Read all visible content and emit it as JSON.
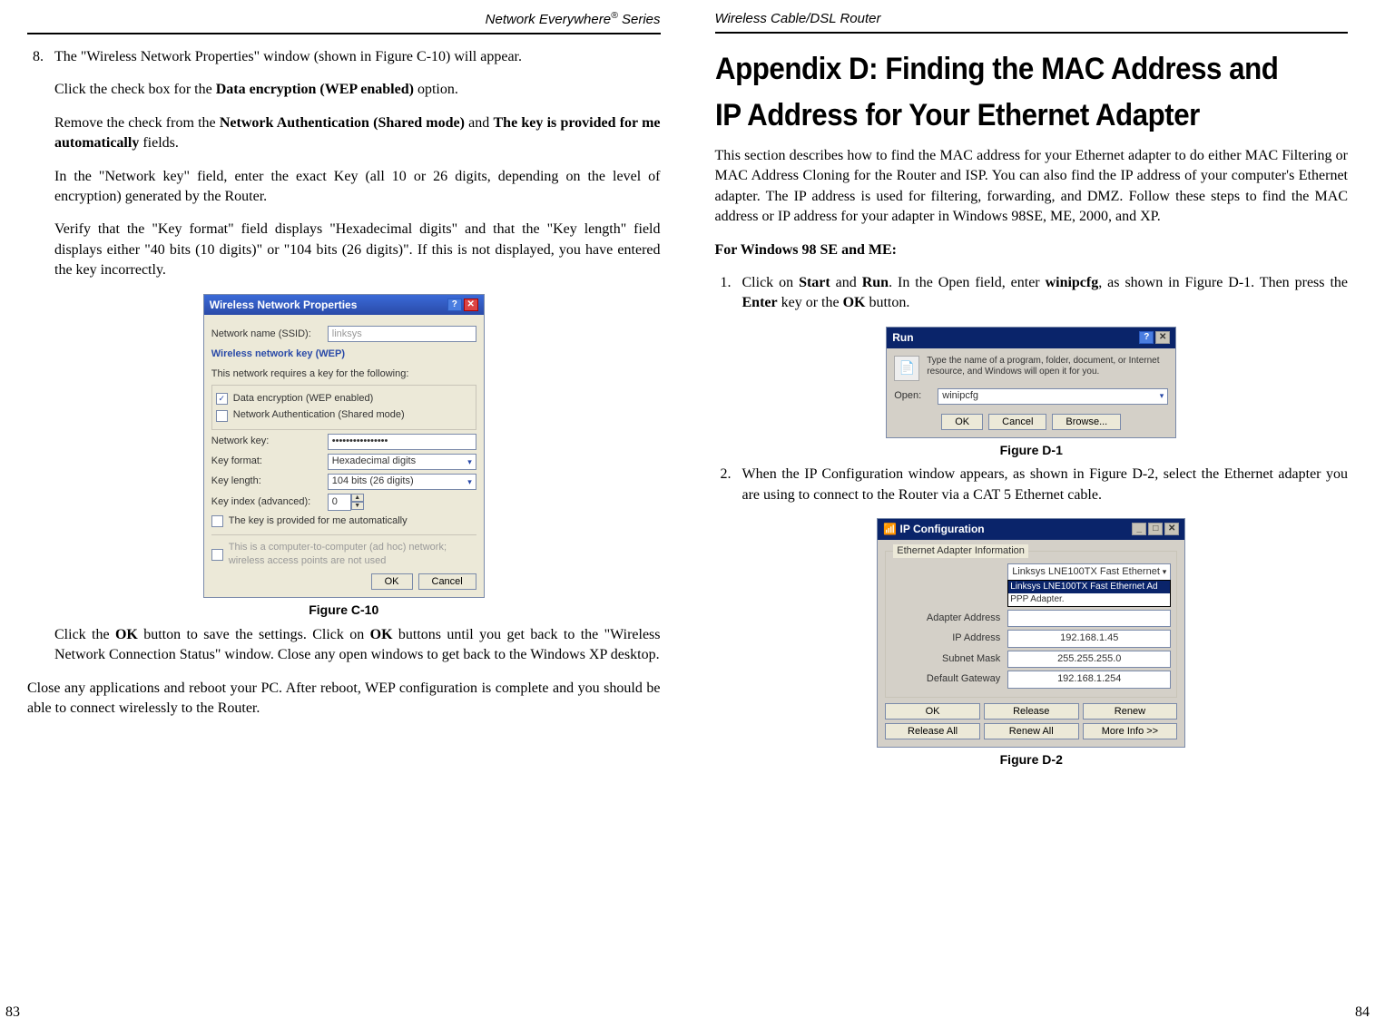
{
  "left_page": {
    "header": "Network Everywhere® Series",
    "page_number": "83",
    "step8": {
      "num": "8.",
      "intro": "The \"Wireless Network Properties\" window (shown in Figure C-10) will appear.",
      "click_checkbox_1": "Click the check box for the ",
      "click_checkbox_bold": "Data encryption (WEP enabled)",
      "click_checkbox_2": " option.",
      "remove_1": "Remove the check from the ",
      "remove_bold1": "Network Authentication (Shared mode)",
      "remove_2": " and ",
      "remove_bold2": "The key is provided for me automatically",
      "remove_3": " fields.",
      "network_key": "In the \"Network key\" field, enter the exact Key (all 10 or 26 digits, depending on the level of encryption) generated by the Router.",
      "verify": "Verify that the \"Key format\" field displays \"Hexadecimal digits\" and that the \"Key length\" field displays either \"40 bits (10 digits)\" or \"104 bits (26 digits)\". If this is not displayed, you have entered the key incorrectly."
    },
    "figure_c10": {
      "caption": "Figure C-10",
      "title": "Wireless Network Properties",
      "ssid_label": "Network name (SSID):",
      "ssid_value": "linksys",
      "wep_header": "Wireless network key (WEP)",
      "wep_desc": "This network requires a key for the following:",
      "chk_data_enc": "Data encryption (WEP enabled)",
      "chk_net_auth": "Network Authentication (Shared mode)",
      "key_label": "Network key:",
      "key_value": "••••••••••••••••",
      "format_label": "Key format:",
      "format_value": "Hexadecimal digits",
      "length_label": "Key length:",
      "length_value": "104 bits (26 digits)",
      "index_label": "Key index (advanced):",
      "index_value": "0",
      "chk_auto": "The key is provided for me automatically",
      "adhoc_text": "This is a computer-to-computer (ad hoc) network; wireless access points are not used",
      "ok": "OK",
      "cancel": "Cancel"
    },
    "click_ok_1": "Click the ",
    "click_ok_bold1": "OK",
    "click_ok_2": " button to save the settings.  Click on ",
    "click_ok_bold2": "OK",
    "click_ok_3": " buttons until you get back to the \"Wireless Network Connection Status\" window.  Close any open windows to get back to the Windows XP desktop.",
    "close_apps": "Close any applications and reboot your PC.  After reboot, WEP configuration is complete and you should be able to connect wirelessly to the Router."
  },
  "right_page": {
    "header": "Wireless Cable/DSL Router",
    "page_number": "84",
    "title": "Appendix D: Finding the MAC Address and IP Address for Your Ethernet Adapter",
    "intro": "This section describes how to find the MAC address for your Ethernet adapter to do either MAC Filtering or MAC Address Cloning for the Router and ISP. You can also find the IP address of your computer's Ethernet adapter.  The IP address is used for filtering, forwarding, and DMZ.  Follow these steps to find the MAC address or IP address for your adapter in Windows 98SE, ME, 2000, and XP.",
    "for_win": "For Windows 98 SE and ME:",
    "step1": {
      "num": "1.",
      "p1": "Click on ",
      "b1": "Start",
      "p2": " and ",
      "b2": "Run",
      "p3": ". In the Open field, enter ",
      "b3": "winipcfg",
      "p4": ", as shown in Figure D-1. Then press the ",
      "b4": "Enter",
      "p5": " key or the ",
      "b5": "OK",
      "p6": " button."
    },
    "figure_d1": {
      "caption": "Figure D-1",
      "title": "Run",
      "desc": "Type the name of a program, folder, document, or Internet resource, and Windows will open it for you.",
      "open_label": "Open:",
      "open_value": "winipcfg",
      "ok": "OK",
      "cancel": "Cancel",
      "browse": "Browse..."
    },
    "step2": {
      "num": "2.",
      "text": "When the IP Configuration window appears, as shown in Figure D-2, select the Ethernet adapter you are using to connect to the Router via a CAT 5 Ethernet cable."
    },
    "figure_d2": {
      "caption": "Figure D-2",
      "title": "IP Configuration",
      "legend": "Ethernet Adapter Information",
      "sel_value": "Linksys LNE100TX Fast Ethernet",
      "sel_opt_hl": "Linksys LNE100TX Fast Ethernet Ad",
      "sel_opt2": "PPP Adapter.",
      "addr_label": "Adapter Address",
      "ip_label": "IP Address",
      "ip_value": "192.168.1.45",
      "mask_label": "Subnet Mask",
      "mask_value": "255.255.255.0",
      "gw_label": "Default Gateway",
      "gw_value": "192.168.1.254",
      "ok": "OK",
      "release": "Release",
      "renew": "Renew",
      "release_all": "Release All",
      "renew_all": "Renew All",
      "more": "More Info >>"
    }
  }
}
